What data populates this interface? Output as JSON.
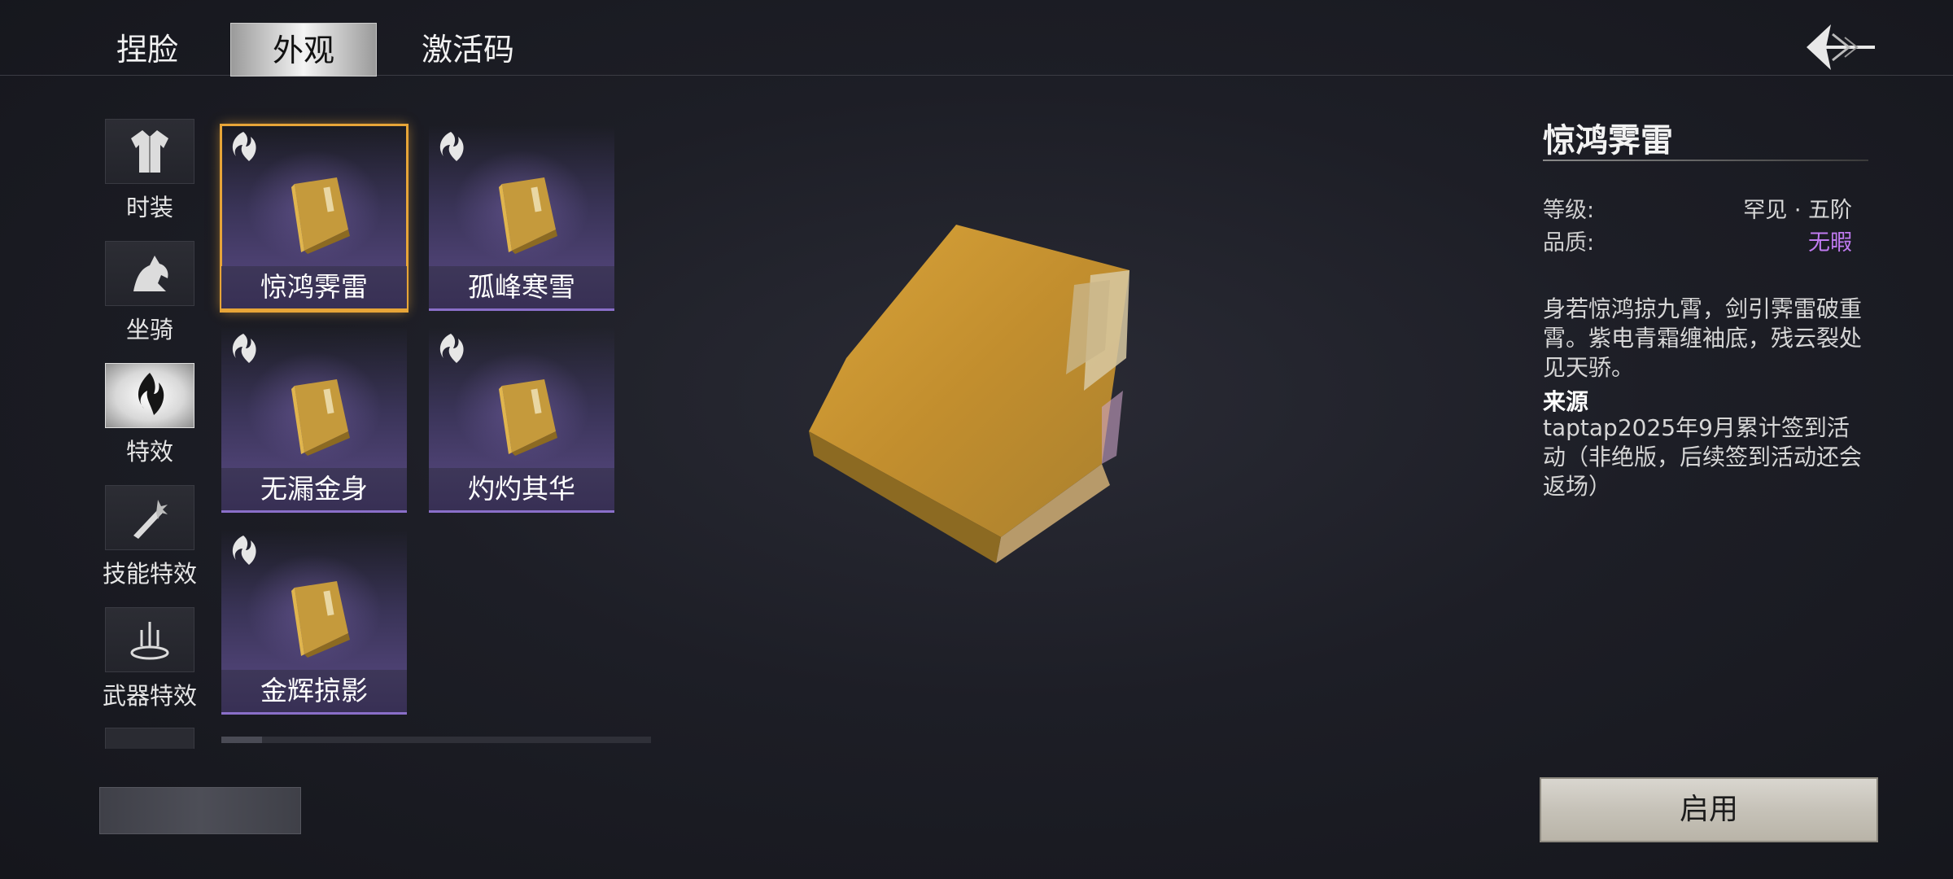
{
  "tabs": [
    {
      "label": "捏脸"
    },
    {
      "label": "外观",
      "active": true
    },
    {
      "label": "激活码"
    }
  ],
  "back_icon": "back-arrow-icon",
  "categories": [
    {
      "label": "时装",
      "icon": "robe-icon"
    },
    {
      "label": "坐骑",
      "icon": "horse-icon"
    },
    {
      "label": "特效",
      "icon": "effect-flame-icon",
      "active": true
    },
    {
      "label": "技能特效",
      "icon": "sword-spark-icon"
    },
    {
      "label": "武器特效",
      "icon": "weapon-aura-icon"
    }
  ],
  "items": [
    {
      "name": "惊鸿霁雷",
      "selected": true
    },
    {
      "name": "孤峰寒雪"
    },
    {
      "name": "无漏金身"
    },
    {
      "name": "灼灼其华"
    },
    {
      "name": "金辉掠影"
    }
  ],
  "detail": {
    "title": "惊鸿霁雷",
    "level_label": "等级:",
    "level_value": "罕见 · 五阶",
    "quality_label": "品质:",
    "quality_value": "无暇",
    "description": "身若惊鸿掠九霄，剑引霁雷破重霄。紫电青霜缠袖底，残云裂处见天骄。",
    "source_heading": "来源",
    "source_text": "taptap2025年9月累计签到活动（非绝版，后续签到活动还会返场）",
    "use_button": "启用"
  },
  "colors": {
    "selected_border": "#e7a538",
    "quality_purple": "#c07af0",
    "item_bar": "#8a6fc9"
  }
}
